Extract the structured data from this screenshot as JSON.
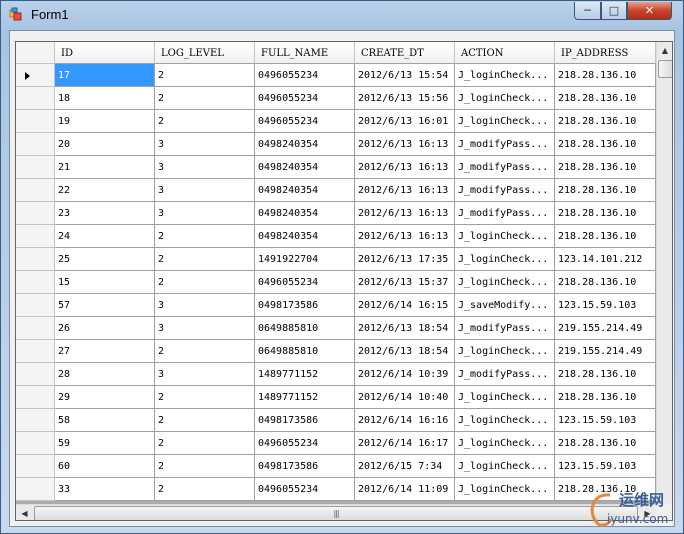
{
  "window": {
    "title": "Form1"
  },
  "grid": {
    "columns": [
      "ID",
      "LOG_LEVEL",
      "FULL_NAME",
      "CREATE_DT",
      "ACTION",
      "IP_ADDRESS"
    ],
    "rows": [
      [
        "17",
        "2",
        "0496055234",
        "2012/6/13 15:54",
        "J_loginCheck...",
        "218.28.136.10"
      ],
      [
        "18",
        "2",
        "0496055234",
        "2012/6/13 15:56",
        "J_loginCheck...",
        "218.28.136.10"
      ],
      [
        "19",
        "2",
        "0496055234",
        "2012/6/13 16:01",
        "J_loginCheck...",
        "218.28.136.10"
      ],
      [
        "20",
        "3",
        "0498240354",
        "2012/6/13 16:13",
        "J_modifyPass...",
        "218.28.136.10"
      ],
      [
        "21",
        "3",
        "0498240354",
        "2012/6/13 16:13",
        "J_modifyPass...",
        "218.28.136.10"
      ],
      [
        "22",
        "3",
        "0498240354",
        "2012/6/13 16:13",
        "J_modifyPass...",
        "218.28.136.10"
      ],
      [
        "23",
        "3",
        "0498240354",
        "2012/6/13 16:13",
        "J_modifyPass...",
        "218.28.136.10"
      ],
      [
        "24",
        "2",
        "0498240354",
        "2012/6/13 16:13",
        "J_loginCheck...",
        "218.28.136.10"
      ],
      [
        "25",
        "2",
        "1491922704",
        "2012/6/13 17:35",
        "J_loginCheck...",
        "123.14.101.212"
      ],
      [
        "15",
        "2",
        "0496055234",
        "2012/6/13 15:37",
        "J_loginCheck...",
        "218.28.136.10"
      ],
      [
        "57",
        "3",
        "0498173586",
        "2012/6/14 16:15",
        "J_saveModify...",
        "123.15.59.103"
      ],
      [
        "26",
        "3",
        "0649885810",
        "2012/6/13 18:54",
        "J_modifyPass...",
        "219.155.214.49"
      ],
      [
        "27",
        "2",
        "0649885810",
        "2012/6/13 18:54",
        "J_loginCheck...",
        "219.155.214.49"
      ],
      [
        "28",
        "3",
        "1489771152",
        "2012/6/14 10:39",
        "J_modifyPass...",
        "218.28.136.10"
      ],
      [
        "29",
        "2",
        "1489771152",
        "2012/6/14 10:40",
        "J_loginCheck...",
        "218.28.136.10"
      ],
      [
        "58",
        "2",
        "0498173586",
        "2012/6/14 16:16",
        "J_loginCheck...",
        "123.15.59.103"
      ],
      [
        "59",
        "2",
        "0496055234",
        "2012/6/14 16:17",
        "J_loginCheck...",
        "218.28.136.10"
      ],
      [
        "60",
        "2",
        "0498173586",
        "2012/6/15 7:34",
        "J_loginCheck...",
        "123.15.59.103"
      ],
      [
        "33",
        "2",
        "0496055234",
        "2012/6/14 11:09",
        "J_loginCheck...",
        "218.28.136.10"
      ]
    ],
    "selected_row": 0,
    "hscroll_grip": "|||"
  },
  "watermark": {
    "text": "运维网",
    "url": "iyunv.com"
  },
  "colors": {
    "selection": "#3399ff",
    "close_button": "#c8452a"
  }
}
